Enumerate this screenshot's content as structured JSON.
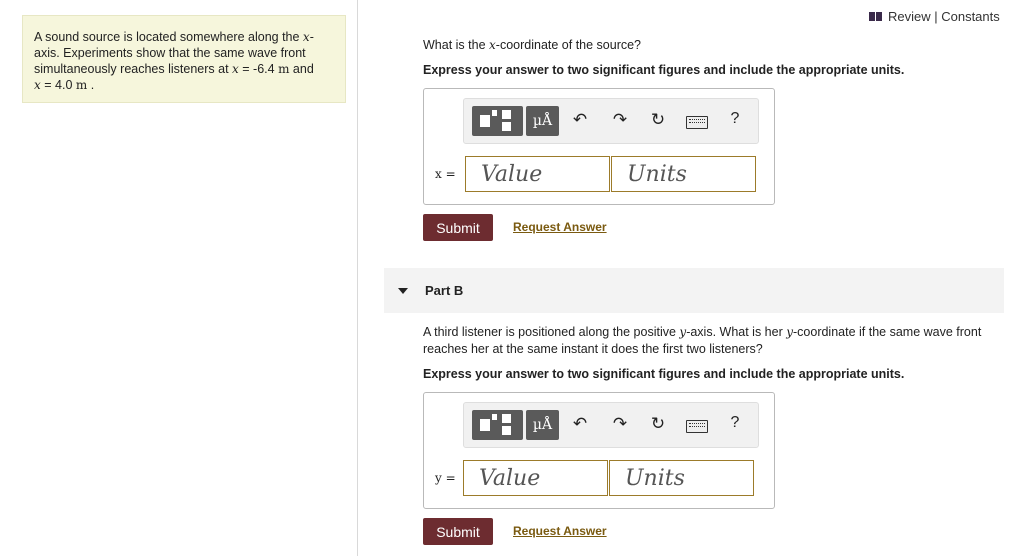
{
  "problem": {
    "line1_prefix": "A sound source is located somewhere along the ",
    "line1_var": "x",
    "line1_suffix": "-",
    "line2": "axis. Experiments show that the same wave front",
    "line3_prefix": "simultaneously reaches listeners at ",
    "line3_var": "x",
    "line3_eq": " = -6.4 ",
    "line3_unit": "m",
    "line3_and": " and",
    "line4_var": "x",
    "line4_eq": " = 4.0 ",
    "line4_unit": "m",
    "line4_end": " ."
  },
  "header": {
    "review_constants": "Review | Constants"
  },
  "partA": {
    "question_prefix": "What is the ",
    "question_var": "x",
    "question_suffix": "-coordinate of the source?",
    "instruction": "Express your answer to two significant figures and include the appropriate units.",
    "var_label": "x =",
    "value_placeholder": "Value",
    "units_placeholder": "Units",
    "submit": "Submit",
    "request": "Request Answer"
  },
  "partB": {
    "title": "Part B",
    "question_line1_a": "A third listener is positioned along the positive ",
    "question_var1": "y",
    "question_line1_b": "-axis. What is her ",
    "question_var2": "y",
    "question_line1_c": "-coordinate if the same wave front",
    "question_line2": "reaches her at the same instant it does the first two listeners?",
    "instruction": "Express your answer to two significant figures and include the appropriate units.",
    "var_label": "y =",
    "value_placeholder": "Value",
    "units_placeholder": "Units",
    "submit": "Submit",
    "request": "Request Answer"
  },
  "toolbar": {
    "mu_label": "µÅ",
    "undo_icon": "↶",
    "redo_icon": "↷",
    "reset_icon": "↻",
    "help_label": "?"
  }
}
